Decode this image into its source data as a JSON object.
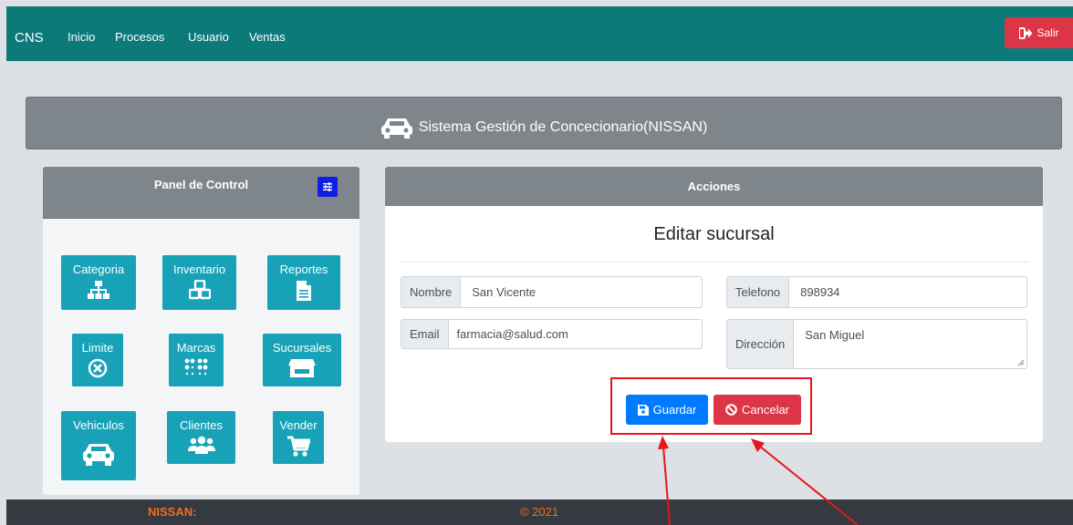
{
  "nav": {
    "brand": "CNS",
    "links": [
      "Inicio",
      "Procesos",
      "Usuario",
      "Ventas"
    ],
    "logout_label": "Salir"
  },
  "header": {
    "title": "Sistema Gestión de Concecionario(NISSAN)"
  },
  "panel": {
    "title": "Panel de Control",
    "tiles": [
      {
        "label": "Categoria",
        "icon": "sitemap-icon"
      },
      {
        "label": "Inventario",
        "icon": "cubes-icon"
      },
      {
        "label": "Reportes",
        "icon": "file-icon"
      },
      {
        "label": "Limite",
        "icon": "times-circle-icon"
      },
      {
        "label": "Marcas",
        "icon": "braille-icon"
      },
      {
        "label": "Sucursales",
        "icon": "store-icon"
      },
      {
        "label": "Vehiculos",
        "icon": "car-icon"
      },
      {
        "label": "Clientes",
        "icon": "users-icon"
      },
      {
        "label": "Vender",
        "icon": "cart-icon"
      }
    ]
  },
  "acciones": {
    "header": "Acciones",
    "form_title": "Editar sucursal",
    "fields": {
      "nombre": {
        "label": "Nombre",
        "value": "San Vicente"
      },
      "telefono": {
        "label": "Telefono",
        "value": "898934"
      },
      "email": {
        "label": "Email",
        "value": "farmacia@salud.com"
      },
      "direccion": {
        "label": "Dirección",
        "value": "San Miguel"
      }
    },
    "save_label": "Guardar",
    "cancel_label": "Cancelar"
  },
  "footer": {
    "brand": "NISSAN:",
    "copyright": "© 2021"
  },
  "colors": {
    "navbar": "#0d7a7a",
    "danger": "#dc3545",
    "primary": "#007bff",
    "info": "#17a2b8",
    "annotation": "#e8141a"
  }
}
